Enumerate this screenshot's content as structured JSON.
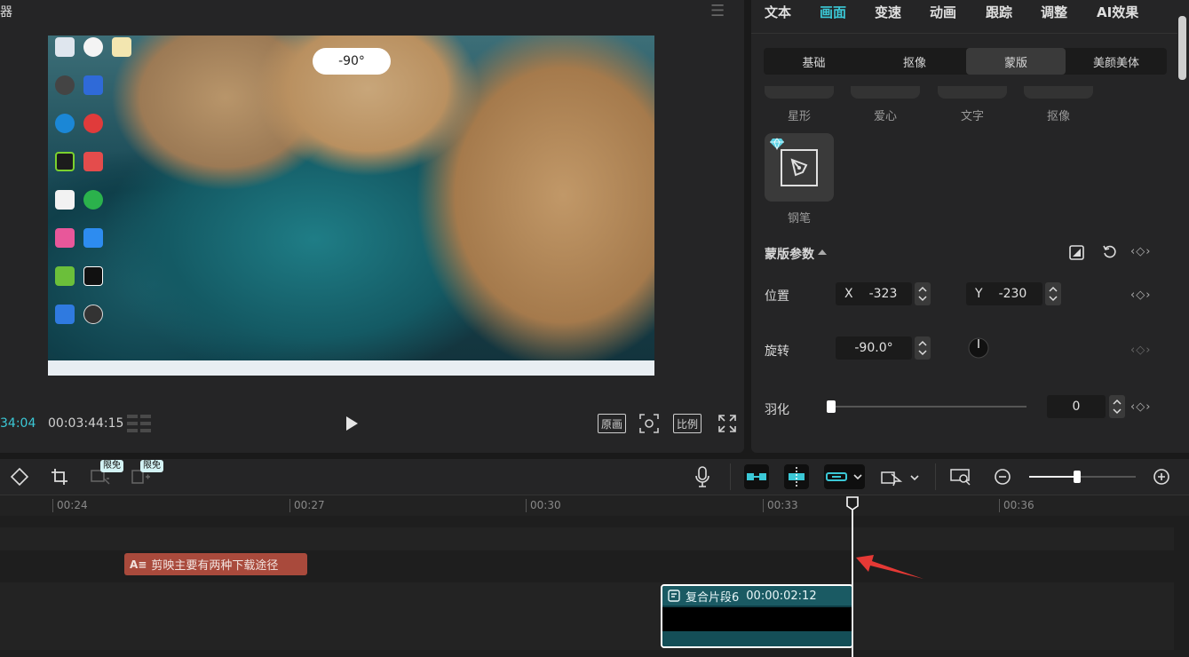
{
  "player": {
    "title": "器",
    "angle_value": "-90°",
    "current_time": "34:04",
    "total_time": "00:03:44:15",
    "btn_original": "原画",
    "btn_ratio": "比例"
  },
  "inspector": {
    "tabs": [
      "文本",
      "画面",
      "变速",
      "动画",
      "跟踪",
      "调整",
      "AI效果"
    ],
    "active_tab": "画面",
    "subtabs": [
      "基础",
      "抠像",
      "蒙版",
      "美颜美体"
    ],
    "active_subtab": "蒙版",
    "shape_labels": [
      "星形",
      "爱心",
      "文字",
      "抠像"
    ],
    "pen_label": "钢笔",
    "section_title": "蒙版参数",
    "position_label": "位置",
    "x_label": "X",
    "x_value": "-323",
    "y_label": "Y",
    "y_value": "-230",
    "rotation_label": "旋转",
    "rotation_value": "-90.0°",
    "feather_label": "羽化",
    "feather_value": "0",
    "feather_fraction": 0
  },
  "timeline": {
    "badges": [
      "限免",
      "限免"
    ],
    "ticks": [
      "00:24",
      "00:27",
      "00:30",
      "00:33",
      "00:36"
    ],
    "zoom_fraction": 0.45,
    "text_clip": "剪映主要有两种下载途径",
    "comp_clip_name": "复合片段6",
    "comp_clip_duration": "00:00:02:12"
  },
  "colors": {
    "accent": "#3bc8d6",
    "text_clip": "#a94a3c",
    "arrow": "#e53935"
  }
}
